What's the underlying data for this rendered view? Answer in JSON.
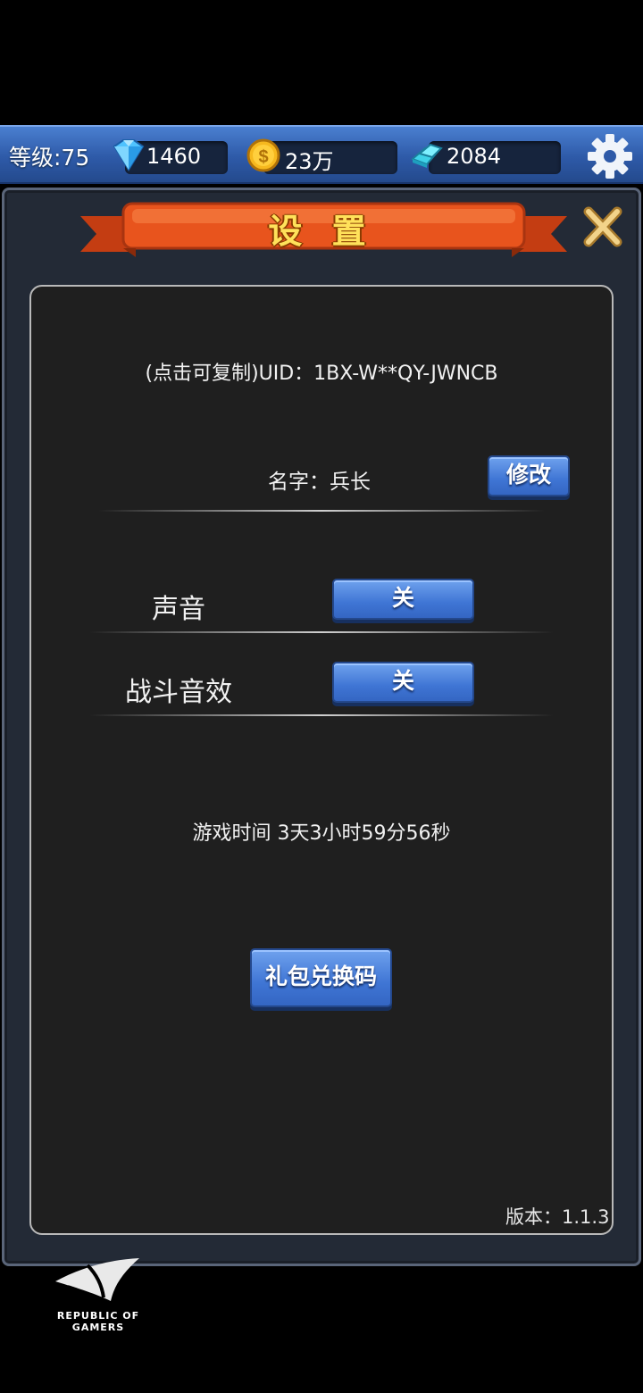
{
  "header": {
    "level_label": "等级:75",
    "diamonds": "1460",
    "gold": "23万",
    "crystals": "2084"
  },
  "dialog": {
    "title": "设 置",
    "uid_text": "(点击可复制)UID：1BX-W**QY-JWNCB",
    "name_text": "名字：兵长",
    "rename_button": "修改",
    "sound_label": "声音",
    "sound_button": "关",
    "battle_sfx_label": "战斗音效",
    "battle_sfx_button": "关",
    "playtime_text": "游戏时间 3天3小时59分56秒",
    "gift_code_button": "礼包兑换码",
    "version_text": "版本：1.1.3"
  },
  "watermark": {
    "line1": "REPUBLIC OF",
    "line2": "GAMERS"
  },
  "colors": {
    "accent_blue": "#3f75d4",
    "title_yellow": "#ffe15a",
    "ribbon_orange": "#e8541d"
  }
}
